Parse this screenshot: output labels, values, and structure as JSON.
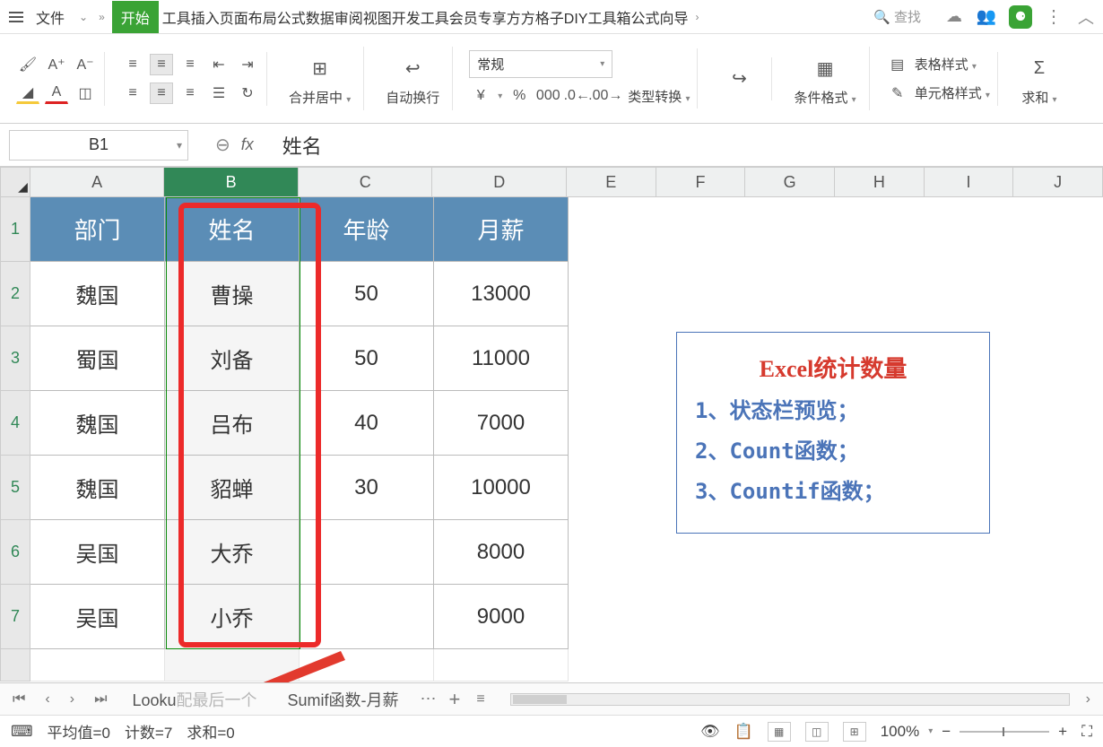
{
  "menubar": {
    "file": "文件",
    "active_tab": "开始",
    "other_tabs": "工具插入页面布局公式数据审阅视图开发工具会员专享方方格子DIY工具箱公式向导",
    "search_placeholder": "查找"
  },
  "ribbon": {
    "merge_center": "合并居中",
    "wrap_text": "自动换行",
    "number_format": "常规",
    "type_convert": "类型转换",
    "cond_format": "条件格式",
    "table_style": "表格样式",
    "cell_style": "单元格样式",
    "sum": "求和"
  },
  "namebox": "B1",
  "formula_value": "姓名",
  "columns": [
    "A",
    "B",
    "C",
    "D",
    "E",
    "F",
    "G",
    "H",
    "I",
    "J"
  ],
  "rows": [
    "1",
    "2",
    "3",
    "4",
    "5",
    "6",
    "7"
  ],
  "table": {
    "headers": [
      "部门",
      "姓名",
      "年龄",
      "月薪"
    ],
    "data": [
      [
        "魏国",
        "曹操",
        "50",
        "13000"
      ],
      [
        "蜀国",
        "刘备",
        "50",
        "11000"
      ],
      [
        "魏国",
        "吕布",
        "40",
        "7000"
      ],
      [
        "魏国",
        "貂蝉",
        "30",
        "10000"
      ],
      [
        "吴国",
        "大乔",
        "",
        "8000"
      ],
      [
        "吴国",
        "小乔",
        "",
        "9000"
      ]
    ]
  },
  "callout": {
    "title": "Excel统计数量",
    "line1": "1、状态栏预览；",
    "line2": "2、Count函数；",
    "line3": "3、Countif函数；"
  },
  "sheets": {
    "tab1_partial": "Looku",
    "tab1_rest": "配最后一个",
    "tab2": "Sumif函数-月薪"
  },
  "statusbar": {
    "avg": "平均值=0",
    "count": "计数=7",
    "sum": "求和=0",
    "zoom": "100%"
  }
}
